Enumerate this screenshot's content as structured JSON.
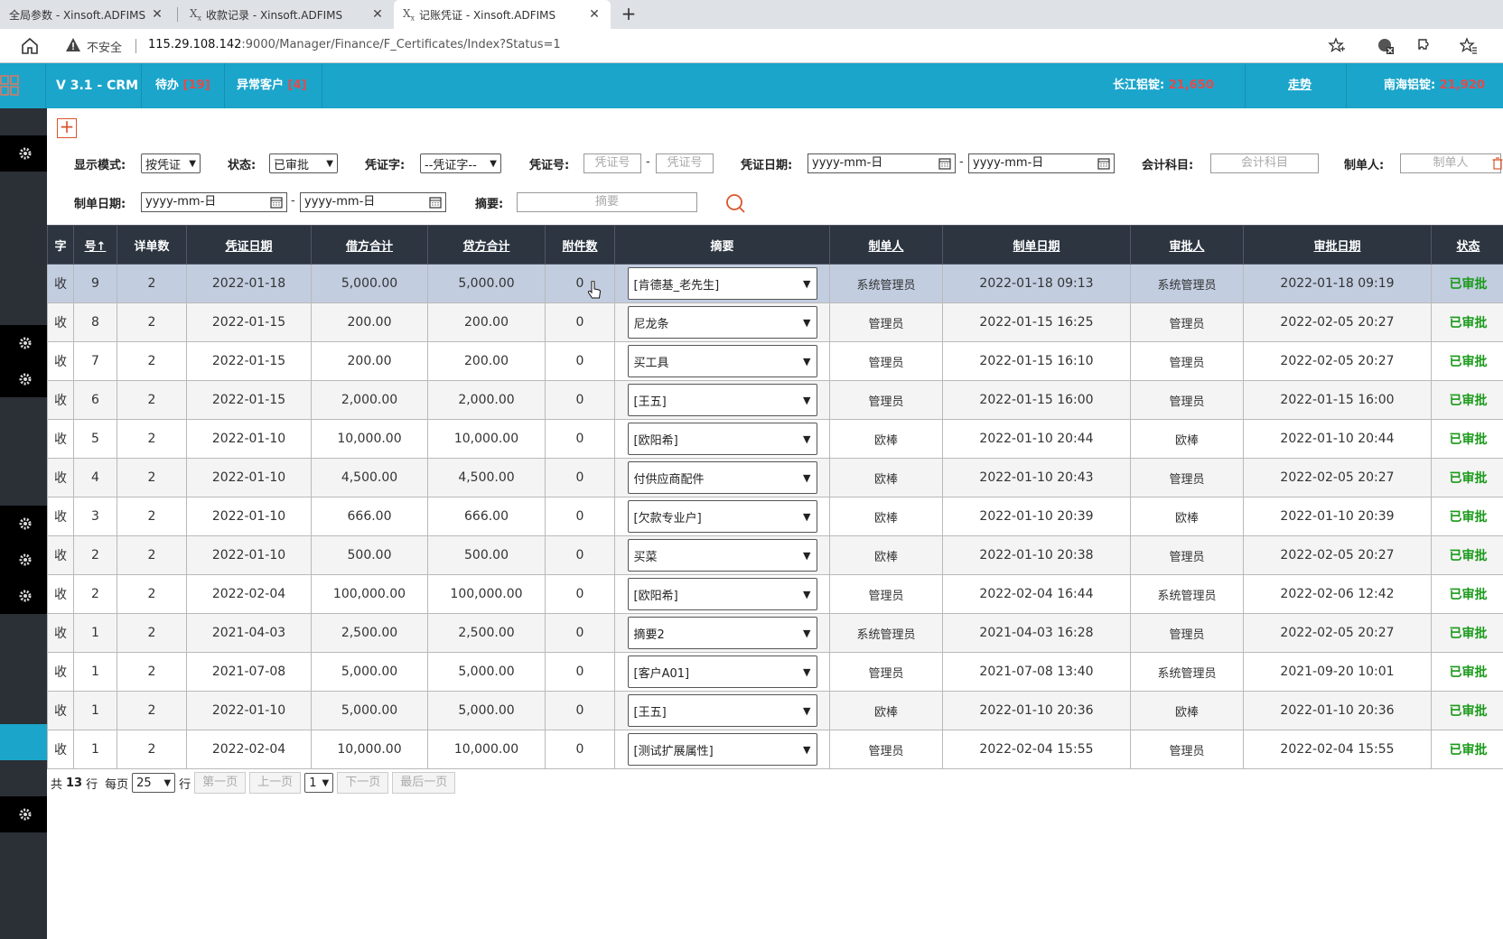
{
  "browser": {
    "tabs": [
      {
        "title": "全局参数 - Xinsoft.ADFIMS",
        "active": false
      },
      {
        "title": "收款记录 - Xinsoft.ADFIMS",
        "active": false
      },
      {
        "title": "记账凭证 - Xinsoft.ADFIMS",
        "active": true
      }
    ],
    "insecure_label": "不安全",
    "url_host": "115.29.108.142",
    "url_rest": ":9000/Manager/Finance/F_Certificates/Index?Status=1"
  },
  "header": {
    "version": "V 3.1 - CRM",
    "todo_label": "待办",
    "todo_count": "[19]",
    "abnormal_label": "异常客户",
    "abnormal_count": "[4]",
    "cj_label": "长江铝锭:",
    "cj_value": "21,650",
    "trend_label": "走势",
    "nh_label": "南海铝锭:",
    "nh_value": "21,920"
  },
  "filters": {
    "display_mode_label": "显示模式:",
    "display_mode_value": "按凭证",
    "status_label": "状态:",
    "status_value": "已审批",
    "cert_word_label": "凭证字:",
    "cert_word_value": "--凭证字--",
    "cert_no_label": "凭证号:",
    "cert_no_placeholder": "凭证号",
    "cert_date_label": "凭证日期:",
    "date_placeholder": "yyyy-mm-日",
    "account_label": "会计科目:",
    "account_placeholder": "会计科目",
    "maker_label": "制单人:",
    "maker_placeholder": "制单人",
    "make_date_label": "制单日期:",
    "summary_label": "摘要:",
    "summary_placeholder": "摘要",
    "dash": "-"
  },
  "table": {
    "headers": [
      "字",
      "号↑",
      "详单数",
      "凭证日期",
      "借方合计",
      "贷方合计",
      "附件数",
      "摘要",
      "制单人",
      "制单日期",
      "审批人",
      "审批日期",
      "状态"
    ],
    "rows": [
      [
        "收",
        "9",
        "2",
        "2022-01-18",
        "5,000.00",
        "5,000.00",
        "0",
        "[肯德基_老先生]",
        "系统管理员",
        "2022-01-18 09:13",
        "系统管理员",
        "2022-01-18 09:19",
        "已审批"
      ],
      [
        "收",
        "8",
        "2",
        "2022-01-15",
        "200.00",
        "200.00",
        "0",
        "尼龙条",
        "管理员",
        "2022-01-15 16:25",
        "管理员",
        "2022-02-05 20:27",
        "已审批"
      ],
      [
        "收",
        "7",
        "2",
        "2022-01-15",
        "200.00",
        "200.00",
        "0",
        "买工具",
        "管理员",
        "2022-01-15 16:10",
        "管理员",
        "2022-02-05 20:27",
        "已审批"
      ],
      [
        "收",
        "6",
        "2",
        "2022-01-15",
        "2,000.00",
        "2,000.00",
        "0",
        "[王五]",
        "管理员",
        "2022-01-15 16:00",
        "管理员",
        "2022-01-15 16:00",
        "已审批"
      ],
      [
        "收",
        "5",
        "2",
        "2022-01-10",
        "10,000.00",
        "10,000.00",
        "0",
        "[欧阳希]",
        "欧棒",
        "2022-01-10 20:44",
        "欧棒",
        "2022-01-10 20:44",
        "已审批"
      ],
      [
        "收",
        "4",
        "2",
        "2022-01-10",
        "4,500.00",
        "4,500.00",
        "0",
        "付供应商配件",
        "欧棒",
        "2022-01-10 20:43",
        "管理员",
        "2022-02-05 20:27",
        "已审批"
      ],
      [
        "收",
        "3",
        "2",
        "2022-01-10",
        "666.00",
        "666.00",
        "0",
        "[欠款专业户]",
        "欧棒",
        "2022-01-10 20:39",
        "欧棒",
        "2022-01-10 20:39",
        "已审批"
      ],
      [
        "收",
        "2",
        "2",
        "2022-01-10",
        "500.00",
        "500.00",
        "0",
        "买菜",
        "欧棒",
        "2022-01-10 20:38",
        "管理员",
        "2022-02-05 20:27",
        "已审批"
      ],
      [
        "收",
        "2",
        "2",
        "2022-02-04",
        "100,000.00",
        "100,000.00",
        "0",
        "[欧阳希]",
        "管理员",
        "2022-02-04 16:44",
        "系统管理员",
        "2022-02-06 12:42",
        "已审批"
      ],
      [
        "收",
        "1",
        "2",
        "2021-04-03",
        "2,500.00",
        "2,500.00",
        "0",
        "摘要2",
        "系统管理员",
        "2021-04-03 16:28",
        "管理员",
        "2022-02-05 20:27",
        "已审批"
      ],
      [
        "收",
        "1",
        "2",
        "2021-07-08",
        "5,000.00",
        "5,000.00",
        "0",
        "[客户A01]",
        "管理员",
        "2021-07-08 13:40",
        "系统管理员",
        "2021-09-20 10:01",
        "已审批"
      ],
      [
        "收",
        "1",
        "2",
        "2022-01-10",
        "5,000.00",
        "5,000.00",
        "0",
        "[王五]",
        "欧棒",
        "2022-01-10 20:36",
        "欧棒",
        "2022-01-10 20:36",
        "已审批"
      ],
      [
        "收",
        "1",
        "2",
        "2022-02-04",
        "10,000.00",
        "10,000.00",
        "0",
        "[测试扩展属性]",
        "管理员",
        "2022-02-04 15:55",
        "管理员",
        "2022-02-04 15:55",
        "已审批"
      ]
    ]
  },
  "pager": {
    "total_prefix": "共",
    "total": "13",
    "total_suffix": "行",
    "per_page_label": "每页",
    "per_page": "25",
    "per_page_suffix": "行",
    "first": "第一页",
    "prev": "上一页",
    "page": "1",
    "next": "下一页",
    "last": "最后一页"
  },
  "colors": {
    "accent": "#1ba5cb",
    "header_dark": "#2c3540",
    "status_green": "#1a9a1a",
    "alert_red": "#e34b4b"
  }
}
